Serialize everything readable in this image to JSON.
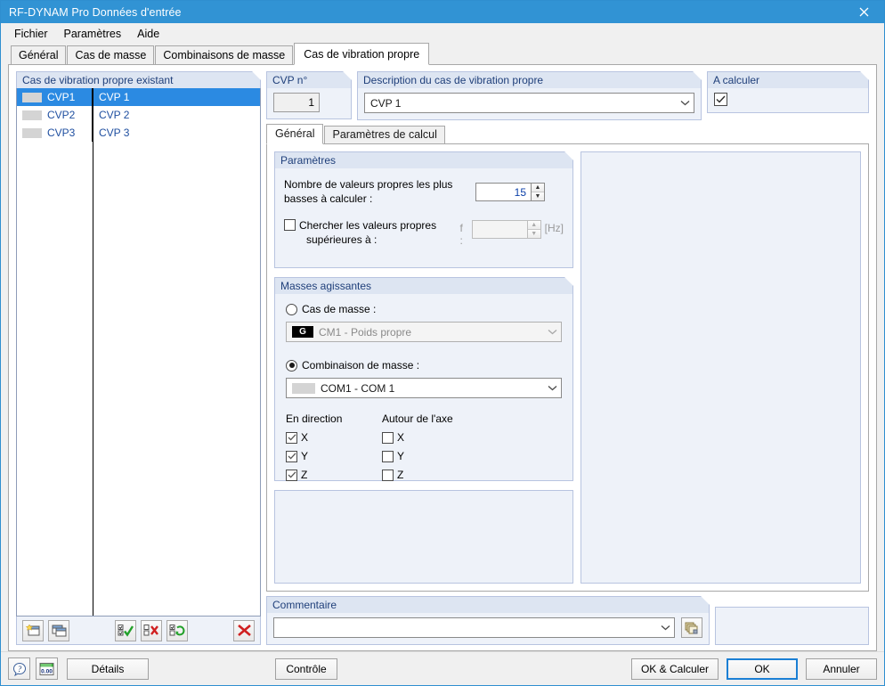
{
  "window": {
    "title": "RF-DYNAM Pro Données d'entrée",
    "close_icon": "close-icon"
  },
  "menu": {
    "items": [
      {
        "label": "Fichier"
      },
      {
        "label": "Paramètres"
      },
      {
        "label": "Aide"
      }
    ]
  },
  "tabs": {
    "items": [
      {
        "label": "Général",
        "active": false
      },
      {
        "label": "Cas de masse",
        "active": false
      },
      {
        "label": "Combinaisons de masse",
        "active": false
      },
      {
        "label": "Cas de vibration propre",
        "active": true
      }
    ]
  },
  "left_panel": {
    "header": "Cas de vibration propre existant",
    "rows": [
      {
        "code": "CVP1",
        "name": "CVP 1",
        "selected": true
      },
      {
        "code": "CVP2",
        "name": "CVP 2",
        "selected": false
      },
      {
        "code": "CVP3",
        "name": "CVP 3",
        "selected": false
      }
    ],
    "toolbar": {
      "new": "new-item-button",
      "copy": "copy-item-button",
      "check_all": "check-all-button",
      "uncheck_all": "uncheck-all-button",
      "toggle": "toggle-selection-button",
      "delete": "delete-item-button"
    }
  },
  "case_no": {
    "header": "CVP n°",
    "value": "1"
  },
  "description": {
    "header": "Description du cas de vibration propre",
    "value": "CVP 1"
  },
  "to_calculate": {
    "header": "A calculer",
    "checked": true
  },
  "inner_tabs": {
    "items": [
      {
        "label": "Général",
        "active": true
      },
      {
        "label": "Paramètres de calcul",
        "active": false
      }
    ]
  },
  "parameters": {
    "title": "Paramètres",
    "eigenvalues_label_line1": "Nombre de valeurs propres les plus",
    "eigenvalues_label_line2": "basses à calculer :",
    "eigenvalues_value": "15",
    "search_above_label_line1": "Chercher les valeurs propres",
    "search_above_label_line2": "supérieures à :",
    "search_above_checked": false,
    "frequency_label": "f :",
    "frequency_value": "",
    "frequency_unit": "[Hz]"
  },
  "acting_masses": {
    "title": "Masses agissantes",
    "mass_case_radio": {
      "label": "Cas de masse :",
      "selected": false
    },
    "mass_case_combo": {
      "badge": "G",
      "value": "CM1 - Poids propre",
      "disabled": true
    },
    "mass_combination_radio": {
      "label": "Combinaison de masse :",
      "selected": true
    },
    "mass_combination_combo": {
      "value": "COM1 - COM 1",
      "disabled": false
    },
    "direction_header": "En direction",
    "axis_header": "Autour de l'axe",
    "direction_items": [
      {
        "label": "X",
        "checked": true
      },
      {
        "label": "Y",
        "checked": true
      },
      {
        "label": "Z",
        "checked": true
      }
    ],
    "axis_items": [
      {
        "label": "X",
        "checked": false
      },
      {
        "label": "Y",
        "checked": false
      },
      {
        "label": "Z",
        "checked": false
      }
    ]
  },
  "comment": {
    "title": "Commentaire",
    "value": "",
    "picker_icon": "comment-library-icon"
  },
  "footer": {
    "help_icon": "help-icon",
    "units_icon": "units-icon",
    "details_label": "Détails",
    "check_label": "Contrôle",
    "ok_calculate_label": "OK & Calculer",
    "ok_label": "OK",
    "cancel_label": "Annuler"
  },
  "colors": {
    "title_bar": "#3193d4",
    "selection": "#2b8ae2",
    "group_bg": "#eef2f9",
    "group_border": "#b8c4e0",
    "label_blue": "#1f3f7a",
    "value_blue": "#0b3fa8"
  }
}
